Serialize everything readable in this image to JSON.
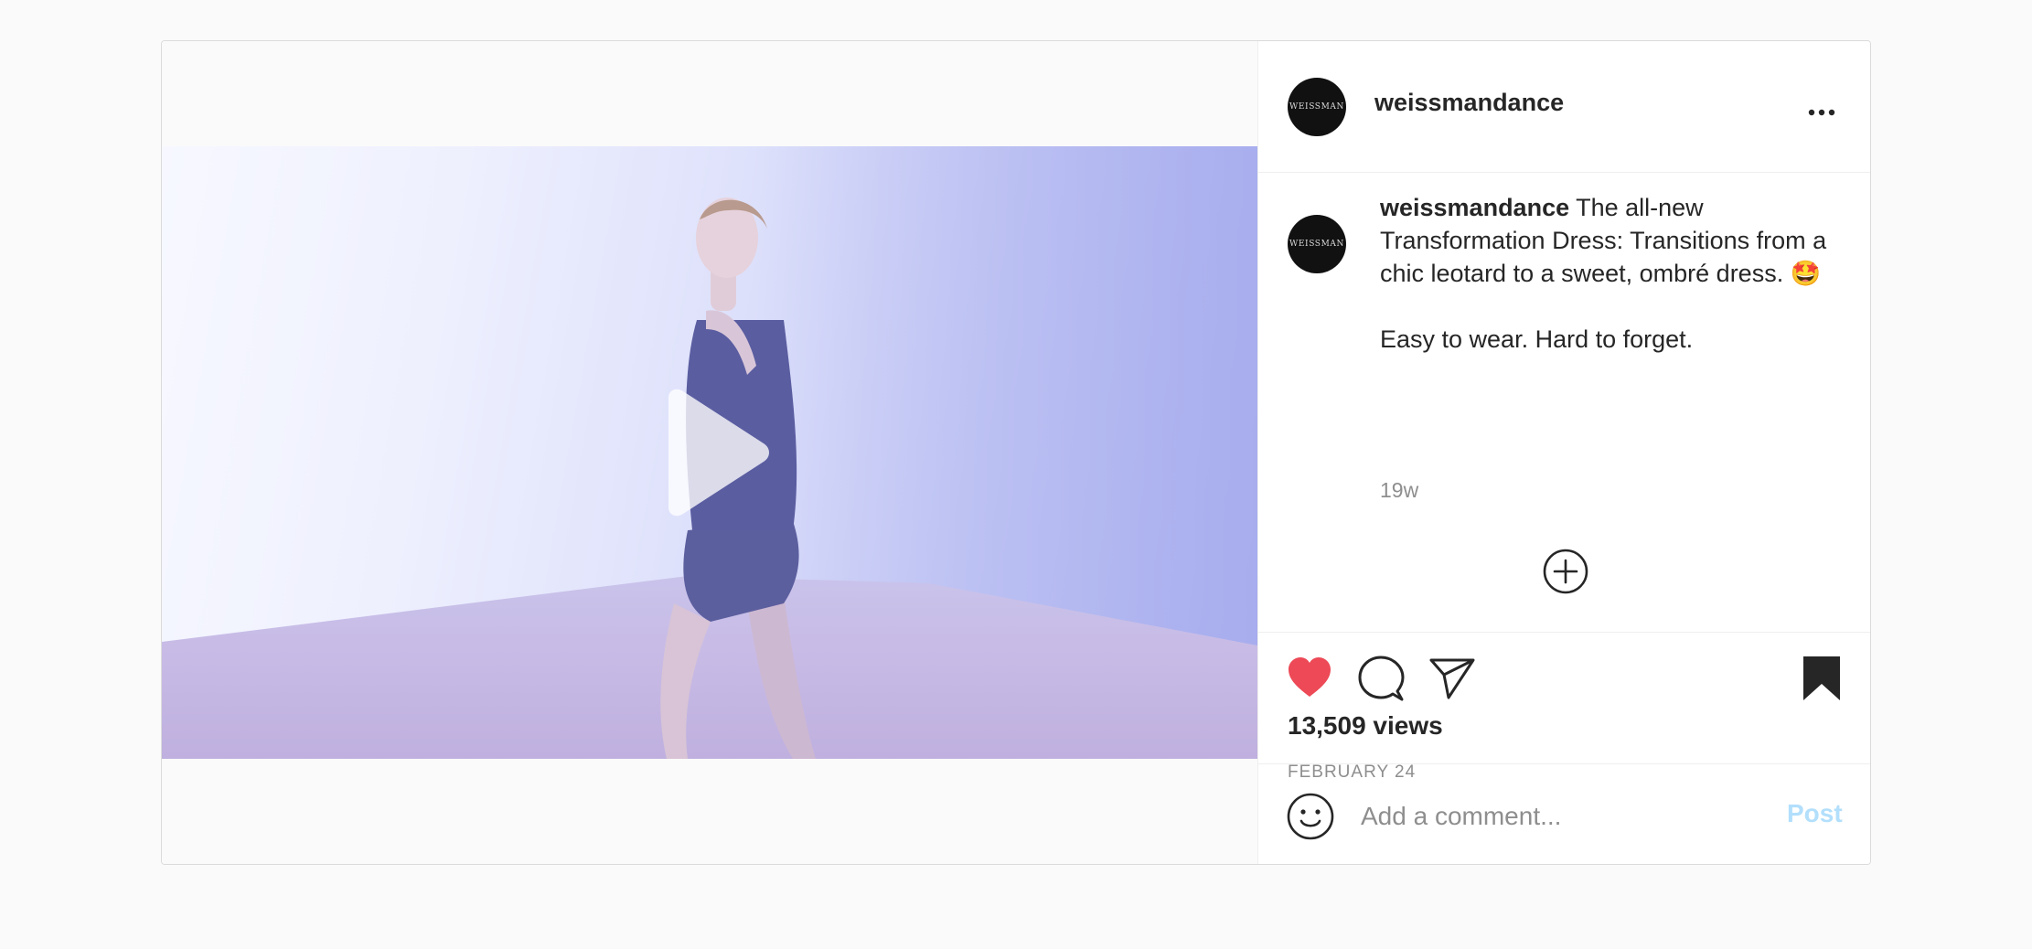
{
  "post": {
    "account": {
      "username": "weissmandance",
      "avatar_text": "WEISSMAN"
    },
    "caption": {
      "username": "weissmandance",
      "text": " The all-new Transformation Dress: Transitions from a chic leotard to a sweet, ombré dress. 🤩",
      "text_line2": "Easy to wear. Hard to forget.",
      "time_ago": "19w"
    },
    "stats": {
      "views": "13,509 views",
      "date": "FEBRUARY 24"
    },
    "actions": {
      "liked": true,
      "saved": true
    },
    "comment_box": {
      "placeholder": "Add a comment...",
      "post_label": "Post"
    }
  },
  "icons": {
    "more": "more-options-icon",
    "play": "play-icon",
    "mute": "muted-speaker-icon",
    "load_more": "plus-circle-icon",
    "like": "heart-icon",
    "comment": "comment-icon",
    "share": "paper-plane-icon",
    "save": "bookmark-icon",
    "emoji": "smiley-icon"
  },
  "colors": {
    "like_red": "#ed4956",
    "post_button": "#b2dffc",
    "text": "#262626",
    "muted_text": "#8e8e8e"
  }
}
